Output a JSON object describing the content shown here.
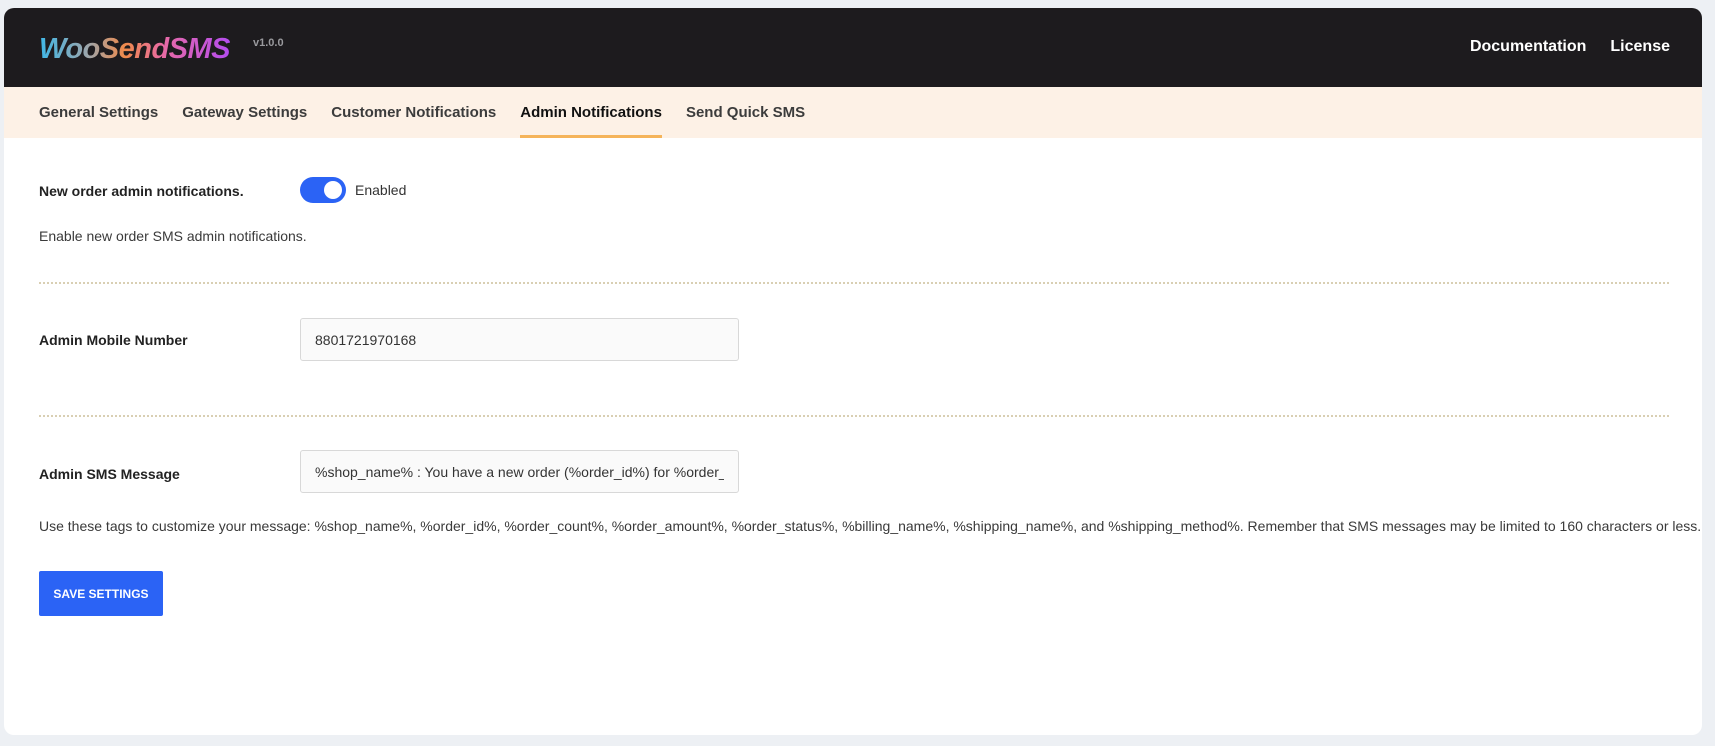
{
  "header": {
    "logo": "WooSendSMS",
    "version": "v1.0.0",
    "links": [
      "Documentation",
      "License"
    ]
  },
  "tabs": [
    {
      "label": "General Settings",
      "active": false
    },
    {
      "label": "Gateway Settings",
      "active": false
    },
    {
      "label": "Customer Notifications",
      "active": false
    },
    {
      "label": "Admin Notifications",
      "active": true
    },
    {
      "label": "Send Quick SMS",
      "active": false
    }
  ],
  "form": {
    "new_order": {
      "label": "New order admin notifications.",
      "toggle_on": true,
      "toggle_label": "Enabled",
      "help": "Enable new order SMS admin notifications."
    },
    "mobile": {
      "label": "Admin Mobile Number",
      "value": "8801721970168"
    },
    "message": {
      "label": "Admin SMS Message",
      "value": "%shop_name% : You have a new order (%order_id%) for %order_amount%",
      "help": "Use these tags to customize your message: %shop_name%, %order_id%, %order_count%, %order_amount%, %order_status%, %billing_name%, %shipping_name%, and %shipping_method%. Remember that SMS messages may be limited to 160 characters or less."
    },
    "save_label": "SAVE SETTINGS"
  },
  "colors": {
    "accent": "#2b63f5",
    "header_bg": "#1d1b1e",
    "tabs_bg": "#fdf1e6",
    "active_tab_underline": "#f5b45a"
  }
}
